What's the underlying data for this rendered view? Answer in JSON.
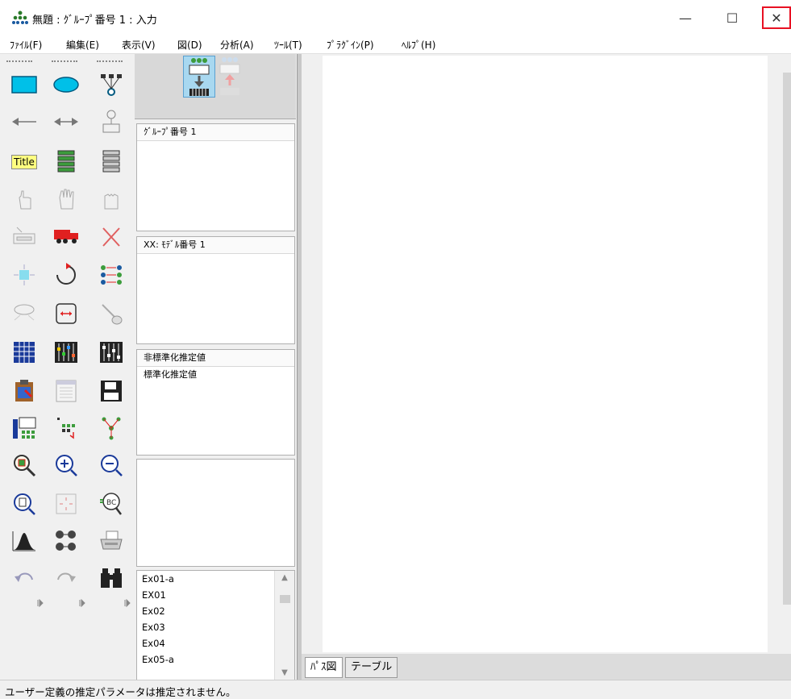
{
  "window": {
    "title": "無題 : ｸﾞﾙｰﾌﾟ番号 1 : 入力",
    "minimize_glyph": "—",
    "maximize_glyph": "☐",
    "close_glyph": "✕"
  },
  "menu": [
    {
      "label": "ﾌｧｲﾙ(F)"
    },
    {
      "label": "編集(E)"
    },
    {
      "label": "表示(V)"
    },
    {
      "label": "図(D)"
    },
    {
      "label": "分析(A)"
    },
    {
      "label": "ﾂｰﾙ(T)"
    },
    {
      "label": "ﾌﾟﾗｸﾞｲﾝ(P)"
    },
    {
      "label": "ﾍﾙﾌﾟ(H)"
    }
  ],
  "toolbox": {
    "title_tool_label": "Title"
  },
  "panels": {
    "groups_header": "ｸﾞﾙｰﾌﾟ番号 1",
    "models_header": "XX: ﾓﾃﾞﾙ番号 1",
    "estimates_header": "非標準化推定値",
    "estimates_item": "標準化推定値"
  },
  "files": [
    "Ex01-a",
    "EX01",
    "Ex02",
    "Ex03",
    "Ex04",
    "Ex05-a"
  ],
  "tabs": {
    "path_diagram": "ﾊﾟｽ図",
    "table": "テーブル"
  },
  "status": "ユーザー定義の推定パラメータは推定されません。"
}
